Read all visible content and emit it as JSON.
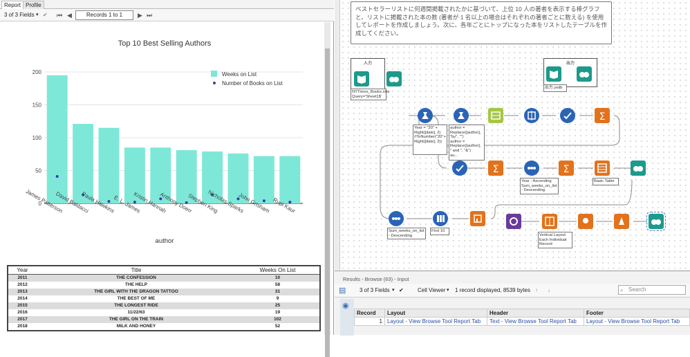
{
  "report_pane": {
    "tabs": [
      "Report",
      "Profile"
    ],
    "fields_dropdown": "3 of 3 Fields",
    "records_label": "Records 1 to 1"
  },
  "chart_data": {
    "type": "bar",
    "title": "Top 10 Best Selling Authors",
    "xlabel": "author",
    "ylabel": "",
    "ylim": [
      0,
      200
    ],
    "yticks": [
      0,
      50,
      100,
      150,
      200
    ],
    "categories": [
      "James Patterson",
      "David Baldacci",
      "Paula Hawkins",
      "E. L. James",
      "Kristin Hannah",
      "Anthony Doerr",
      "Stephen King",
      "Nicholas Sparks",
      "John Grisham",
      "Rupi Kaur"
    ],
    "series": [
      {
        "name": "Weeks on List",
        "kind": "bar",
        "color": "#7de8d8",
        "values": [
          195,
          121,
          115,
          85,
          85,
          81,
          79,
          76,
          72,
          72
        ]
      },
      {
        "name": "Number of Books on List",
        "kind": "scatter",
        "color": "#3a3aaa",
        "values": [
          41,
          13,
          3,
          2,
          7,
          1,
          13,
          7,
          4,
          2
        ]
      }
    ],
    "legend": "top-right",
    "grid": true
  },
  "report_table": {
    "headers": [
      "Year",
      "Title",
      "Weeks On List"
    ],
    "rows": [
      [
        "2011",
        "THE CONFESSION",
        "10"
      ],
      [
        "2012",
        "THE HELP",
        "58"
      ],
      [
        "2013",
        "THE GIRL WITH THE DRAGON TATTOO",
        "31"
      ],
      [
        "2014",
        "THE BEST OF ME",
        "9"
      ],
      [
        "2015",
        "THE LONGEST RIDE",
        "25"
      ],
      [
        "2016",
        "11/22/63",
        "19"
      ],
      [
        "2017",
        "THE GIRL ON THE TRAIN",
        "102"
      ],
      [
        "2018",
        "MILK AND HONEY",
        "52"
      ]
    ]
  },
  "canvas": {
    "note": "ベストセラーリストに何週間掲載されたかに基づいて、上位 10 人の著者を表示する棒グラフと、リストに掲載された本の数 (著者が 1 名以上の場合はそれぞれの著者ごとに数える) を使用してレポートを作成しましょう。次に、各年ごとにトップになった本をリストしたテーブルを作成してください。",
    "input_container_title": "入力",
    "output_container_title": "出力",
    "input_annotation": "NYTimes_Books.xlsx\nQuery='Sheet1$'",
    "output_annotation": "出力.yxdb",
    "formula1_annotation": "Year = \"20\" + Right([date], 2)\n//ToNumber(\"20\"+ Right([date], 2))",
    "formula2_annotation": "author = Replace([author], \"by\", \"\")\nauthor = Replace([author], \" and \", \"&\")\nau...",
    "sort1_annotation": "Year - Ascending\nSum_weeks_on_list - Descending",
    "table_annotation": "Basic Table",
    "sort2_annotation": "Sum_weeks_on_list - Descending",
    "sample_annotation": "First 10",
    "layout_annotation": "Vertical Layout\nEach Individual Record"
  },
  "results": {
    "title": "Results - Browse (63) - Input",
    "fields_dropdown": "3 of 3 Fields",
    "viewer": "Cell Viewer",
    "status": "1 record displayed, 8539 bytes",
    "search_placeholder": "Search",
    "columns": [
      "Record",
      "Layout",
      "Header",
      "Footer"
    ],
    "row": [
      "1",
      "Layout - View Browse Tool Report Tab",
      "Text - View Browse Tool Report Tab",
      "Layout - View Browse Tool Report Tab"
    ]
  },
  "colors": {
    "bar": "#7de8d8",
    "dot": "#3a3aaa",
    "accent_green": "#a6d16b"
  }
}
